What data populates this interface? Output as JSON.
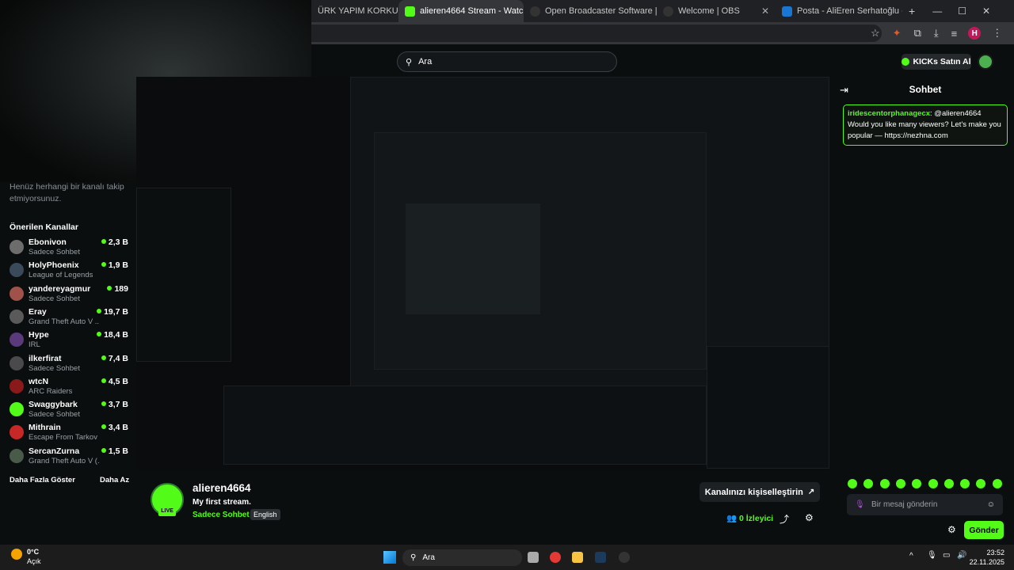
{
  "browser": {
    "tabs": [
      {
        "label": "ÜRK YAPIM KORKU OY",
        "color": "#8e2a2a"
      },
      {
        "label": "alieren4664 Stream - Watc",
        "color": "#53fc18"
      },
      {
        "label": "Open Broadcaster Software | O",
        "color": "#333333"
      },
      {
        "label": "Welcome | OBS",
        "color": "#333333"
      },
      {
        "label": "Posta - AliEren Serhatoğlu - O",
        "color": "#1976d2"
      }
    ],
    "new_tab": "+",
    "profile_initial": "H"
  },
  "header": {
    "search_placeholder": "Ara",
    "kicks_button": "KICKs Satın Al"
  },
  "sidebar": {
    "empty_message": "Henüz herhangi bir kanalı takip etmiyorsunuz.",
    "section_title": "Önerilen Kanallar",
    "channels": [
      {
        "name": "Ebonivon",
        "category": "Sadece Sohbet",
        "count": "2,3 B",
        "color": "#6d6d6d"
      },
      {
        "name": "HolyPhoenix",
        "category": "League of Legends",
        "count": "1,9 B",
        "color": "#3a4a5a"
      },
      {
        "name": "yandereyagmur",
        "category": "Sadece Sohbet",
        "count": "189",
        "color": "#a0524a"
      },
      {
        "name": "Eray",
        "category": "Grand Theft Auto V ...",
        "count": "19,7 B",
        "color": "#5a5a5a"
      },
      {
        "name": "Hype",
        "category": "IRL",
        "count": "18,4 B",
        "color": "#5a3a7a"
      },
      {
        "name": "ilkerfirat",
        "category": "Sadece Sohbet",
        "count": "7,4 B",
        "color": "#4a4a4a"
      },
      {
        "name": "wtcN",
        "category": "ARC Raiders",
        "count": "4,5 B",
        "color": "#8a1a1a"
      },
      {
        "name": "Swaggybark",
        "category": "Sadece Sohbet",
        "count": "3,7 B",
        "color": "#53fc18"
      },
      {
        "name": "Mithrain",
        "category": "Escape From Tarkov",
        "count": "3,4 B",
        "color": "#c62828"
      },
      {
        "name": "SercanZurna",
        "category": "Grand Theft Auto V (...",
        "count": "1,5 B",
        "color": "#4a5a4a"
      }
    ],
    "show_more": "Daha Fazla Göster",
    "show_less": "Daha Az"
  },
  "channel": {
    "name": "alieren4664",
    "stream_title": "My first stream.",
    "category": "Sadece Sohbet",
    "language": "English",
    "live_badge": "LIVE",
    "customize_button": "Kanalınızı kişiselleştirin",
    "viewer_count": "0",
    "viewer_label": "İzleyici"
  },
  "chat": {
    "title": "Sohbet",
    "message_user": "iridescentorphanagecx",
    "message_text": ": @alieren4664 Would you like many viewers? Let's make you popular — https://nezhna.com",
    "input_placeholder": "Bir mesaj gönderin",
    "send_button": "Gönder"
  },
  "taskbar": {
    "weather_temp": "0°C",
    "weather_desc": "Açık",
    "search_label": "Ara",
    "time": "23:52",
    "date": "22.11.2025"
  },
  "colors": {
    "accent": "#53fc18",
    "background": "#0b0e0f"
  }
}
